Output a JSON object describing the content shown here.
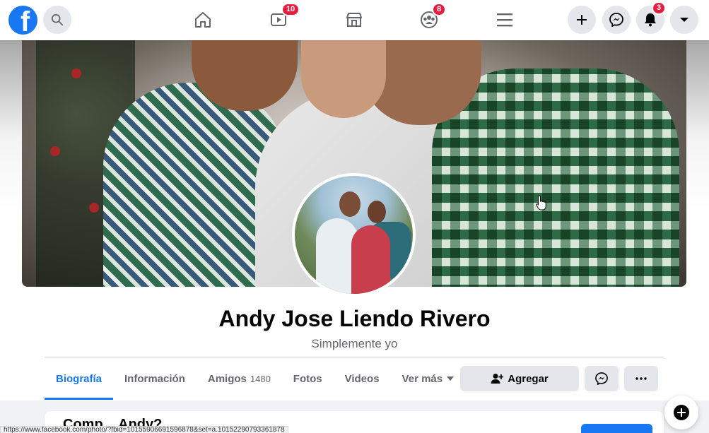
{
  "nav": {
    "logo_letter": "f",
    "badges": {
      "watch": "10",
      "groups": "8",
      "notifications": "3"
    }
  },
  "profile": {
    "name": "Andy Jose Liendo Rivero",
    "bio": "Simplemente yo"
  },
  "tabs": [
    {
      "label": "Biografía",
      "active": true
    },
    {
      "label": "Información"
    },
    {
      "label": "Amigos",
      "count": "1480"
    },
    {
      "label": "Fotos"
    },
    {
      "label": "Videos"
    },
    {
      "label": "Ver más"
    }
  ],
  "actions": {
    "add_friend": "Agregar"
  },
  "card": {
    "title": "Comp... Andy?"
  },
  "status_bar": {
    "url": "https://www.facebook.com/photo/?fbid=10155906691596878&set=a.10152290793361878"
  },
  "colors": {
    "brand": "#1877f2",
    "badge": "#e41e3f"
  }
}
